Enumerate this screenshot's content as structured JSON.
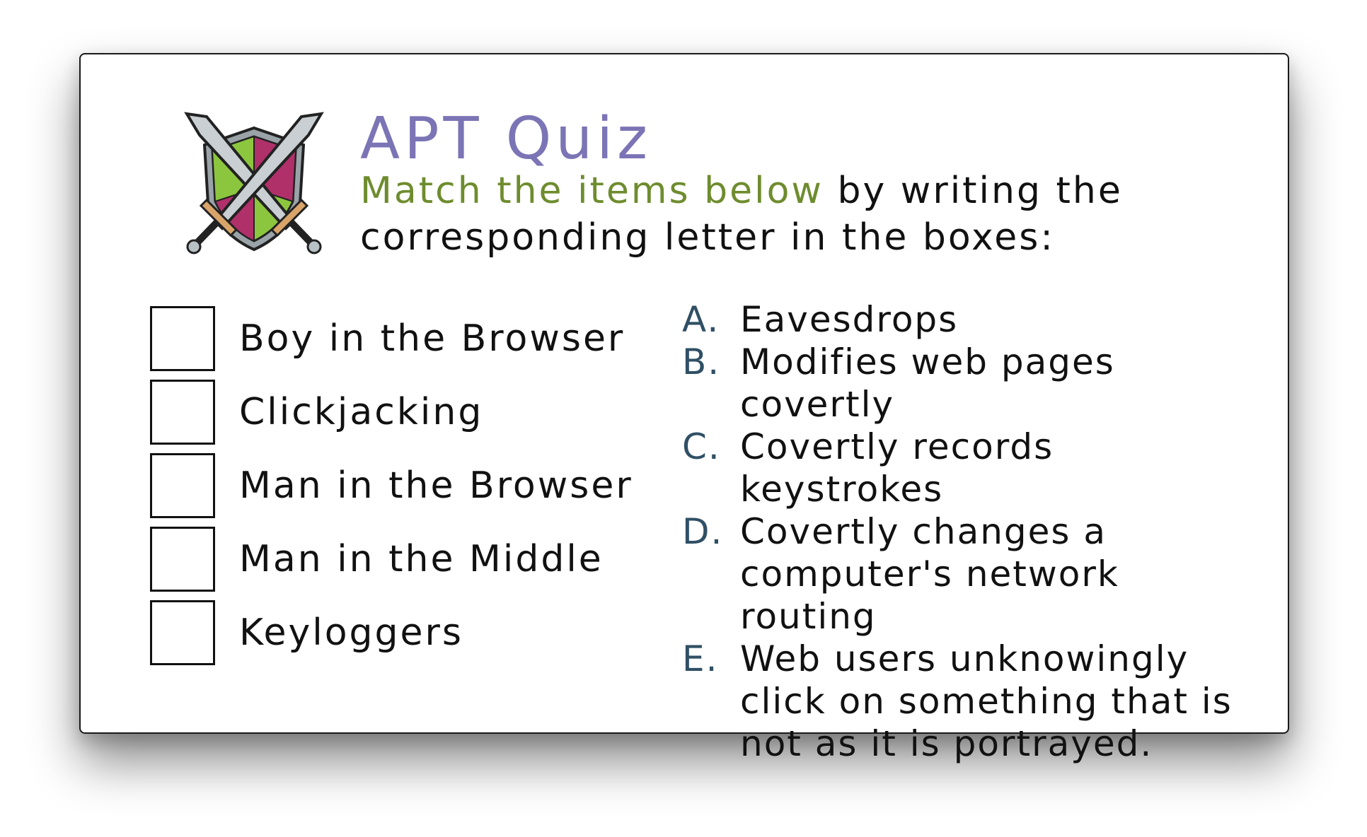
{
  "quiz": {
    "title": "APT Quiz",
    "instructions_highlight": "Match the items below",
    "instructions_rest": " by writing the corresponding letter in the boxes:"
  },
  "items": [
    {
      "label": "Boy in the Browser",
      "answer": ""
    },
    {
      "label": "Clickjacking",
      "answer": ""
    },
    {
      "label": "Man in the Browser",
      "answer": ""
    },
    {
      "label": "Man in the Middle",
      "answer": ""
    },
    {
      "label": "Keyloggers",
      "answer": ""
    }
  ],
  "options": [
    {
      "letter": "A.",
      "text": "Eavesdrops"
    },
    {
      "letter": "B.",
      "text": "Modifies web pages covertly"
    },
    {
      "letter": "C.",
      "text": "Covertly records keystrokes"
    },
    {
      "letter": "D.",
      "text": "Covertly changes a computer's network routing"
    },
    {
      "letter": "E.",
      "text": "Web users unknowingly click on something that is not as it is portrayed."
    }
  ],
  "colors": {
    "title": "#7b74b5",
    "highlight": "#6e8c2e",
    "option_letter": "#2f4f64",
    "shield_green": "#8cc63f",
    "shield_magenta": "#b0306a"
  },
  "icons": {
    "emblem": "crossed-swords-shield-icon"
  }
}
